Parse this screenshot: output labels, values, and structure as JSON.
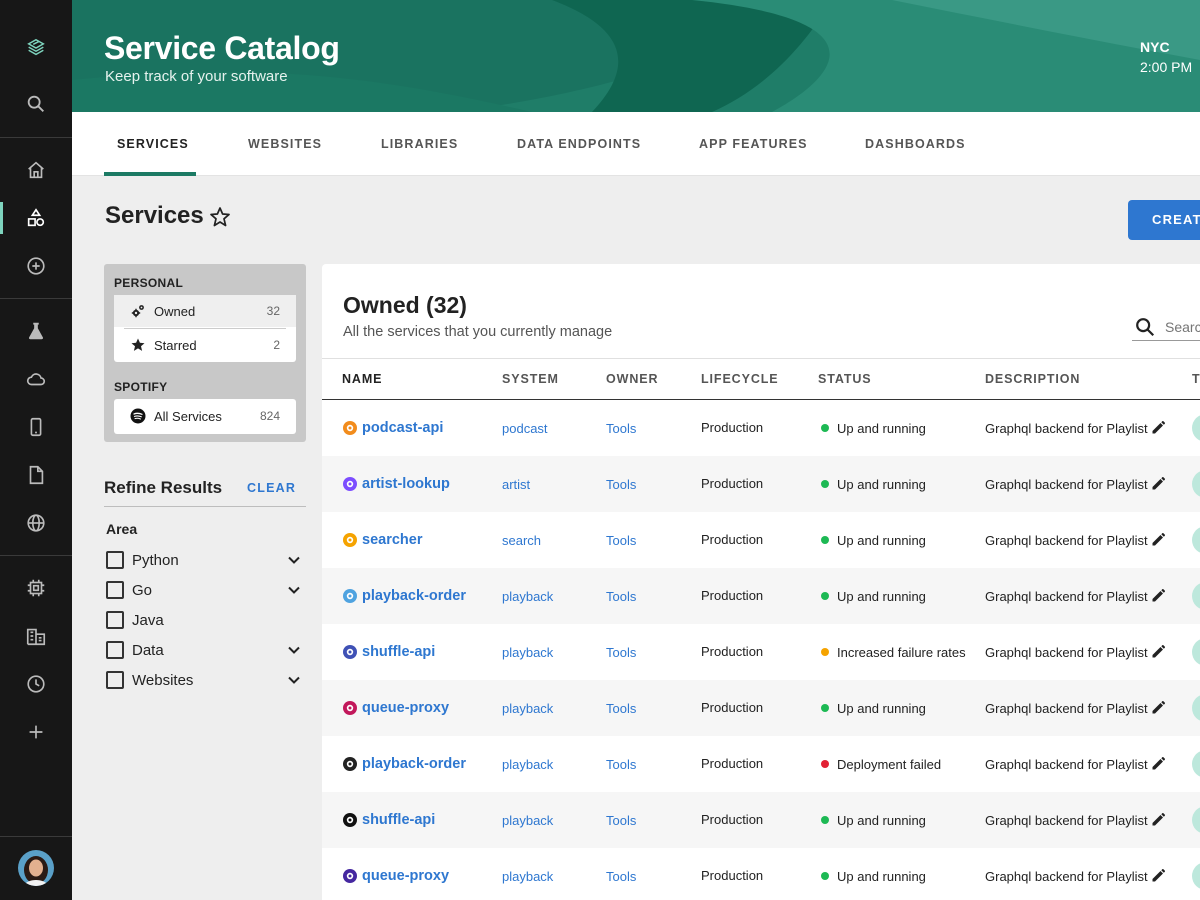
{
  "header": {
    "title": "Service Catalog",
    "subtitle": "Keep track of your software",
    "city": "NYC",
    "time": "2:00 PM"
  },
  "tabs": [
    {
      "label": "SERVICES",
      "active": true
    },
    {
      "label": "WEBSITES",
      "active": false
    },
    {
      "label": "LIBRARIES",
      "active": false
    },
    {
      "label": "DATA ENDPOINTS",
      "active": false
    },
    {
      "label": "APP FEATURES",
      "active": false
    },
    {
      "label": "DASHBOARDS",
      "active": false
    }
  ],
  "page": {
    "title": "Services",
    "create_label": "CREATE"
  },
  "filters": {
    "personal_heading": "PERSONAL",
    "owned_label": "Owned",
    "owned_count": "32",
    "starred_label": "Starred",
    "starred_count": "2",
    "spotify_heading": "SPOTIFY",
    "all_label": "All Services",
    "all_count": "824"
  },
  "refine": {
    "title": "Refine Results",
    "clear_label": "CLEAR",
    "area_label": "Area",
    "options": [
      {
        "label": "Python",
        "expandable": true
      },
      {
        "label": "Go",
        "expandable": true
      },
      {
        "label": "Java",
        "expandable": false
      },
      {
        "label": "Data",
        "expandable": true
      },
      {
        "label": "Websites",
        "expandable": true
      }
    ]
  },
  "card": {
    "title": "Owned (32)",
    "subtitle": "All the services that you currently manage",
    "search_placeholder": "Search"
  },
  "table": {
    "columns": [
      "NAME",
      "SYSTEM",
      "OWNER",
      "LIFECYCLE",
      "STATUS",
      "DESCRIPTION",
      "TAGS"
    ],
    "status_colors": {
      "ok": "#1db954",
      "warn": "#f5a300",
      "error": "#e22134"
    },
    "rows": [
      {
        "name": "podcast-api",
        "system": "podcast",
        "owner": "Tools",
        "lifecycle": "Production",
        "status": "Up and running",
        "status_level": "ok",
        "description": "Graphql backend for Playlist",
        "icon": "podcast-service-icon",
        "icon_color": "#f28c1c"
      },
      {
        "name": "artist-lookup",
        "system": "artist",
        "owner": "Tools",
        "lifecycle": "Production",
        "status": "Up and running",
        "status_level": "ok",
        "description": "Graphql backend for Playlist",
        "icon": "artist-service-icon",
        "icon_color": "#7c4dff"
      },
      {
        "name": "searcher",
        "system": "search",
        "owner": "Tools",
        "lifecycle": "Production",
        "status": "Up and running",
        "status_level": "ok",
        "description": "Graphql backend for Playlist",
        "icon": "search-service-icon",
        "icon_color": "#f5a300"
      },
      {
        "name": "playback-order",
        "system": "playback",
        "owner": "Tools",
        "lifecycle": "Production",
        "status": "Up and running",
        "status_level": "ok",
        "description": "Graphql backend for Playlist",
        "icon": "playback-service-icon",
        "icon_color": "#4fa3e0"
      },
      {
        "name": "shuffle-api",
        "system": "playback",
        "owner": "Tools",
        "lifecycle": "Production",
        "status": "Increased failure rates",
        "status_level": "warn",
        "description": "Graphql backend for Playlist",
        "icon": "shuffle-service-icon",
        "icon_color": "#3f51b5"
      },
      {
        "name": "queue-proxy",
        "system": "playback",
        "owner": "Tools",
        "lifecycle": "Production",
        "status": "Up and running",
        "status_level": "ok",
        "description": "Graphql backend for Playlist",
        "icon": "queue-service-icon",
        "icon_color": "#c2185b"
      },
      {
        "name": "playback-order",
        "system": "playback",
        "owner": "Tools",
        "lifecycle": "Production",
        "status": "Deployment failed",
        "status_level": "error",
        "description": "Graphql backend for Playlist",
        "icon": "playback-service-icon",
        "icon_color": "#222222"
      },
      {
        "name": "shuffle-api",
        "system": "playback",
        "owner": "Tools",
        "lifecycle": "Production",
        "status": "Up and running",
        "status_level": "ok",
        "description": "Graphql backend for Playlist",
        "icon": "shuffle-service-icon",
        "icon_color": "#111111"
      },
      {
        "name": "queue-proxy",
        "system": "playback",
        "owner": "Tools",
        "lifecycle": "Production",
        "status": "Up and running",
        "status_level": "ok",
        "description": "Graphql backend for Playlist",
        "icon": "queue-service-icon",
        "icon_color": "#4527a0"
      }
    ]
  },
  "sidebar": {
    "icons": [
      "logo-icon",
      "search-icon",
      "home-icon",
      "catalog-icon",
      "create-icon",
      "experiments-icon",
      "cloud-icon",
      "mobile-icon",
      "docs-icon",
      "globe-icon",
      "cpu-icon",
      "building-icon",
      "history-icon",
      "add-icon",
      "avatar"
    ],
    "accent": "#7ed4be"
  }
}
